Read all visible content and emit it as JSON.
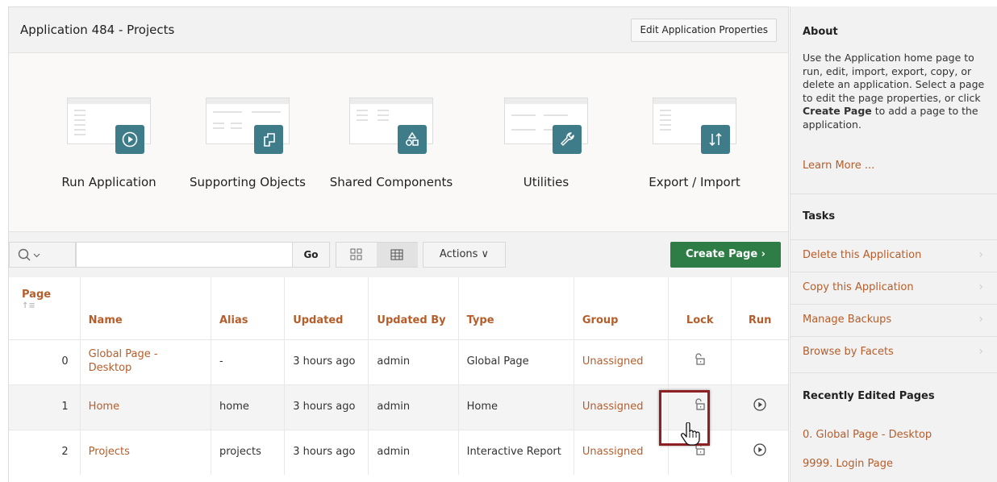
{
  "header": {
    "title": "Application 484 - Projects",
    "edit_props_label": "Edit Application Properties"
  },
  "tiles": [
    {
      "label": "Run Application",
      "icon": "play-icon"
    },
    {
      "label": "Supporting Objects",
      "icon": "supporting-objects-icon"
    },
    {
      "label": "Shared Components",
      "icon": "shared-components-icon"
    },
    {
      "label": "Utilities",
      "icon": "wrench-icon"
    },
    {
      "label": "Export / Import",
      "icon": "export-import-icon"
    }
  ],
  "toolbar": {
    "search_placeholder": "",
    "go_label": "Go",
    "actions_label": "Actions ∨",
    "create_page_label": "Create Page ›"
  },
  "table": {
    "headers": {
      "page": "Page",
      "name": "Name",
      "alias": "Alias",
      "updated": "Updated",
      "updated_by": "Updated By",
      "type": "Type",
      "group": "Group",
      "lock": "Lock",
      "run": "Run"
    },
    "rows": [
      {
        "page": "0",
        "name": "Global Page - Desktop",
        "alias": "-",
        "updated": "3 hours ago",
        "updated_by": "admin",
        "type": "Global Page",
        "group": "Unassigned"
      },
      {
        "page": "1",
        "name": "Home",
        "alias": "home",
        "updated": "3 hours ago",
        "updated_by": "admin",
        "type": "Home",
        "group": "Unassigned"
      },
      {
        "page": "2",
        "name": "Projects",
        "alias": "projects",
        "updated": "3 hours ago",
        "updated_by": "admin",
        "type": "Interactive Report",
        "group": "Unassigned"
      }
    ]
  },
  "sidebar": {
    "about_title": "About",
    "about_text_1": "Use the Application home page to run, edit, import, export, copy, or delete an application. Select a page to edit the page properties, or click ",
    "about_text_bold": "Create Page",
    "about_text_2": " to add a page to the application.",
    "learn_more": "Learn More ...",
    "tasks_title": "Tasks",
    "tasks": [
      "Delete this Application",
      "Copy this Application",
      "Manage Backups",
      "Browse by Facets"
    ],
    "recent_title": "Recently Edited Pages",
    "recent": [
      "0. Global Page - Desktop",
      "9999. Login Page"
    ]
  },
  "colors": {
    "accent": "#b65d2a",
    "badge": "#3e7c8a",
    "create": "#2e7d46",
    "highlight": "#8e1f22"
  }
}
